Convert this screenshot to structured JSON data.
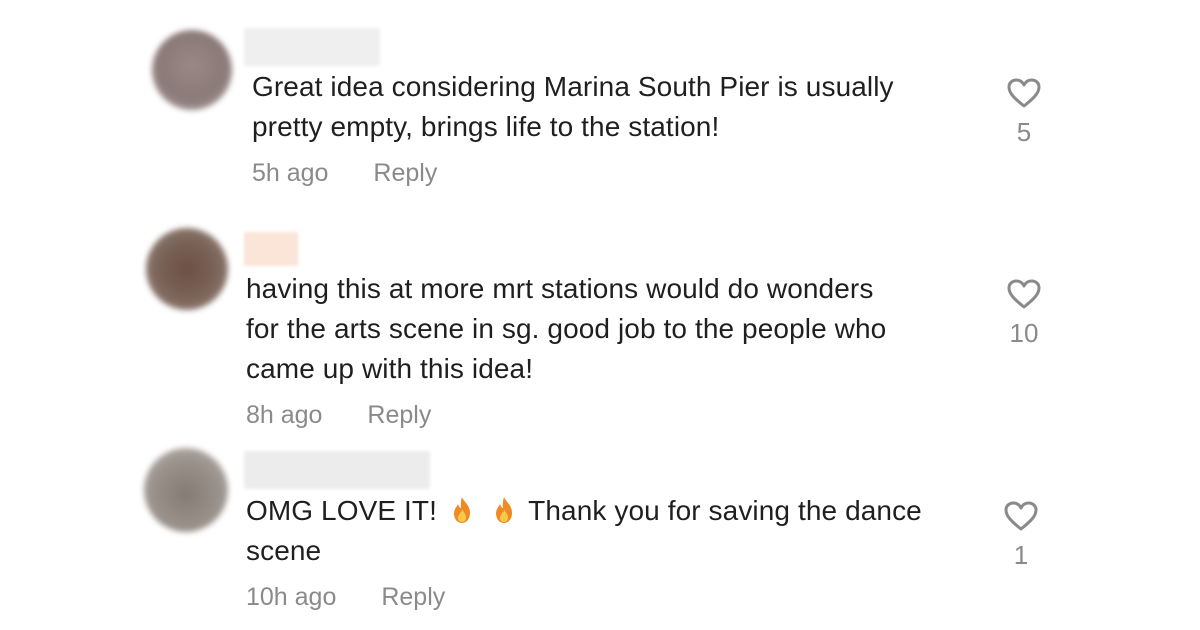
{
  "comments": [
    {
      "text_line1": "Great idea considering Marina South Pier is usually",
      "text_line2": "pretty empty, brings life to the station!",
      "time": "5h ago",
      "reply_label": "Reply",
      "likes": "5",
      "avatar_color": "#8f7f7c",
      "username_bar_color": "#eeeeee"
    },
    {
      "text_line1": "having this at more mrt stations would do wonders",
      "text_line2": "for the arts scene in sg. good job to the people who",
      "text_line3": "came up with this idea!",
      "time": "8h ago",
      "reply_label": "Reply",
      "likes": "10",
      "avatar_color": "#7d6458",
      "username_bar_color": "#fbe6dc"
    },
    {
      "text_part1": "OMG LOVE IT!",
      "emoji_1": "fire-emoji",
      "emoji_2": "fire-emoji",
      "text_part2": "Thank you for saving the dance",
      "text_line2": "scene",
      "time": "10h ago",
      "reply_label": "Reply",
      "likes": "1",
      "avatar_color": "#9a928b",
      "username_bar_color": "#ededed"
    }
  ],
  "icons": {
    "like": "heart-outline-icon"
  },
  "colors": {
    "text": "#1f1f1f",
    "meta": "#8a8a8a",
    "heart_stroke": "#8a8a8a"
  }
}
